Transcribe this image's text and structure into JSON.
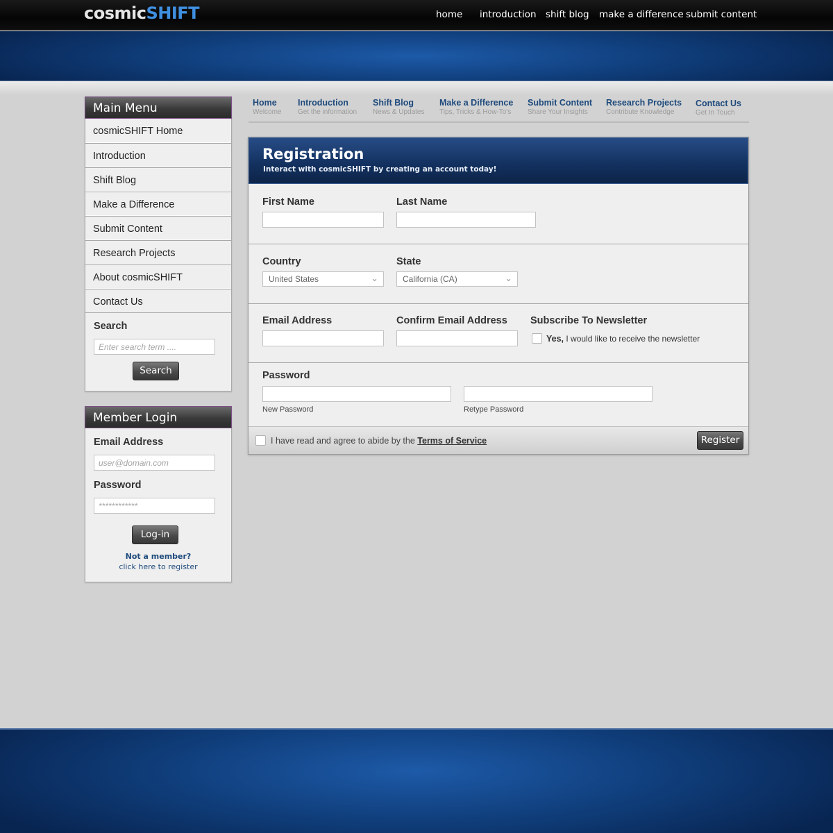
{
  "header": {
    "logo_part1": "cosmic",
    "logo_part2": "SHIFT",
    "nav": [
      "home",
      "introduction",
      "shift blog",
      "make a difference",
      "submit content"
    ]
  },
  "main_menu": {
    "title": "Main Menu",
    "items": [
      "cosmicSHIFT Home",
      "Introduction",
      "Shift Blog",
      "Make a Difference",
      "Submit Content",
      "Research Projects",
      "About cosmicSHIFT",
      "Contact Us"
    ],
    "search_label": "Search",
    "search_placeholder": "Enter search term ....",
    "search_button": "Search"
  },
  "member_login": {
    "title": "Member Login",
    "email_label": "Email Address",
    "email_placeholder": "user@domain.com",
    "password_label": "Password",
    "password_placeholder": "************",
    "login_button": "Log-in",
    "not_member": "Not a member?",
    "register_link": "click here to register"
  },
  "subnav": [
    {
      "title": "Home",
      "sub": "Welcome"
    },
    {
      "title": "Introduction",
      "sub": "Get the information"
    },
    {
      "title": "Shift Blog",
      "sub": "News & Updates"
    },
    {
      "title": "Make a Difference",
      "sub": "Tips, Tricks & How-To's"
    },
    {
      "title": "Submit Content",
      "sub": "Share Your Insights"
    },
    {
      "title": "Research Projects",
      "sub": "Contribute Knowledge"
    },
    {
      "title": "Contact Us",
      "sub": "Get In Touch"
    }
  ],
  "registration": {
    "title": "Registration",
    "subtitle": "Interact with cosmicSHIFT by creating an account today!",
    "first_name_label": "First Name",
    "last_name_label": "Last Name",
    "country_label": "Country",
    "country_value": "United States",
    "state_label": "State",
    "state_value": "California (CA)",
    "email_label": "Email Address",
    "confirm_email_label": "Confirm Email Address",
    "newsletter_label": "Subscribe To Newsletter",
    "newsletter_yes": "Yes,",
    "newsletter_text": "I would like to receive the newsletter",
    "password_label": "Password",
    "new_password_caption": "New Password",
    "retype_password_caption": "Retype Password",
    "terms_text": "I have read and agree to abide by the",
    "terms_link": "Terms of Service",
    "register_button": "Register"
  },
  "colors": {
    "accent_blue": "#3f8fe0",
    "nav_link_blue": "#1e4a7c",
    "hero_blue": "#0f3c78"
  },
  "icons": {
    "select_arrow": "chevron-down-icon",
    "checkbox": "checkbox-icon"
  }
}
